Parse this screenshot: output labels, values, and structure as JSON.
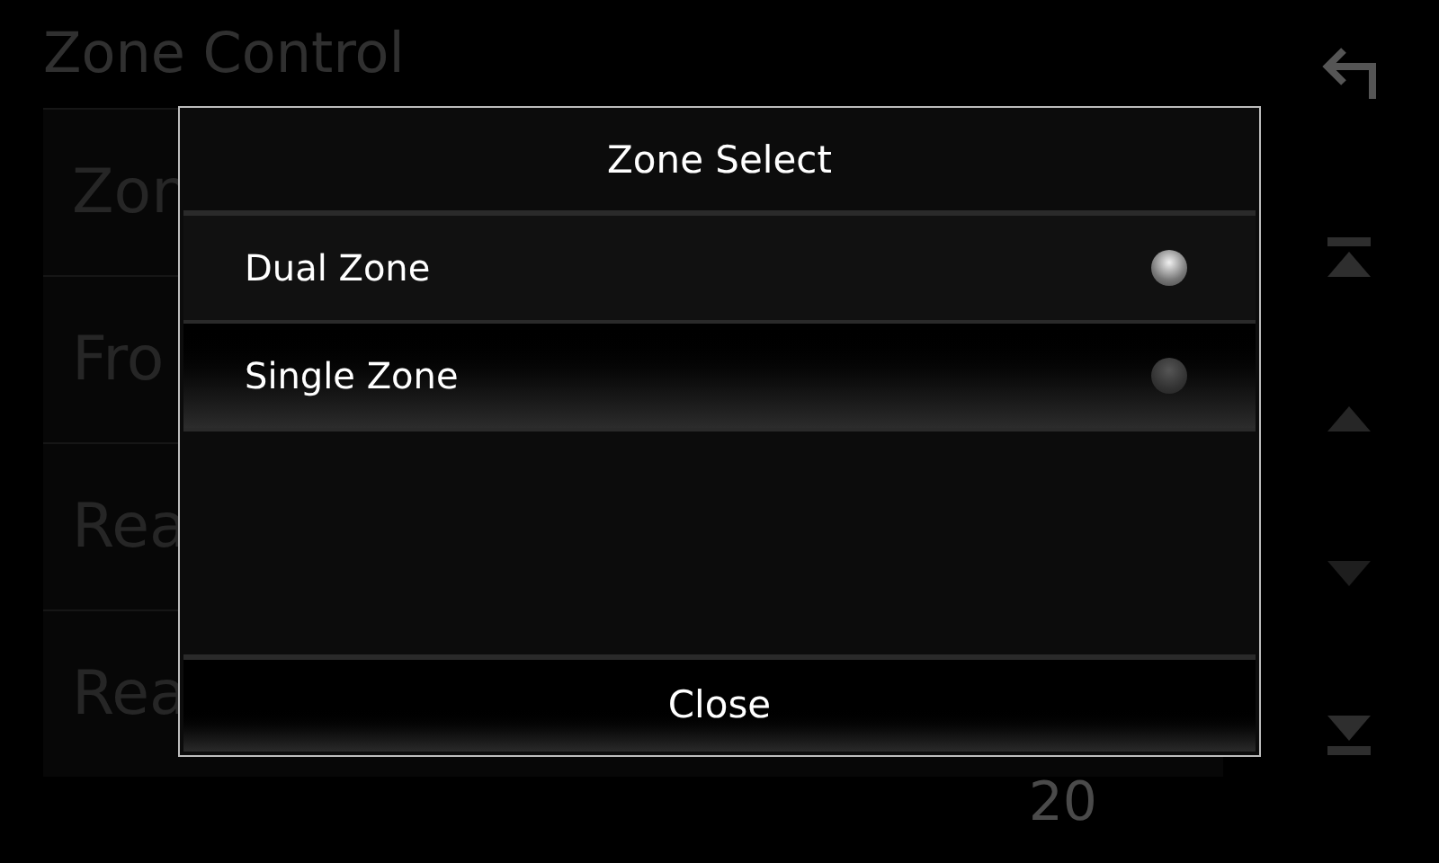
{
  "screen": {
    "title": "Zone Control",
    "rows": [
      {
        "label": "Zon"
      },
      {
        "label": "Fro"
      },
      {
        "label": "Rea"
      },
      {
        "label": "Rea"
      }
    ],
    "value": "20"
  },
  "dialog": {
    "title": "Zone Select",
    "options": [
      {
        "label": "Dual Zone",
        "selected": true,
        "focused": false
      },
      {
        "label": "Single Zone",
        "selected": false,
        "focused": true
      }
    ],
    "button": "Close"
  }
}
